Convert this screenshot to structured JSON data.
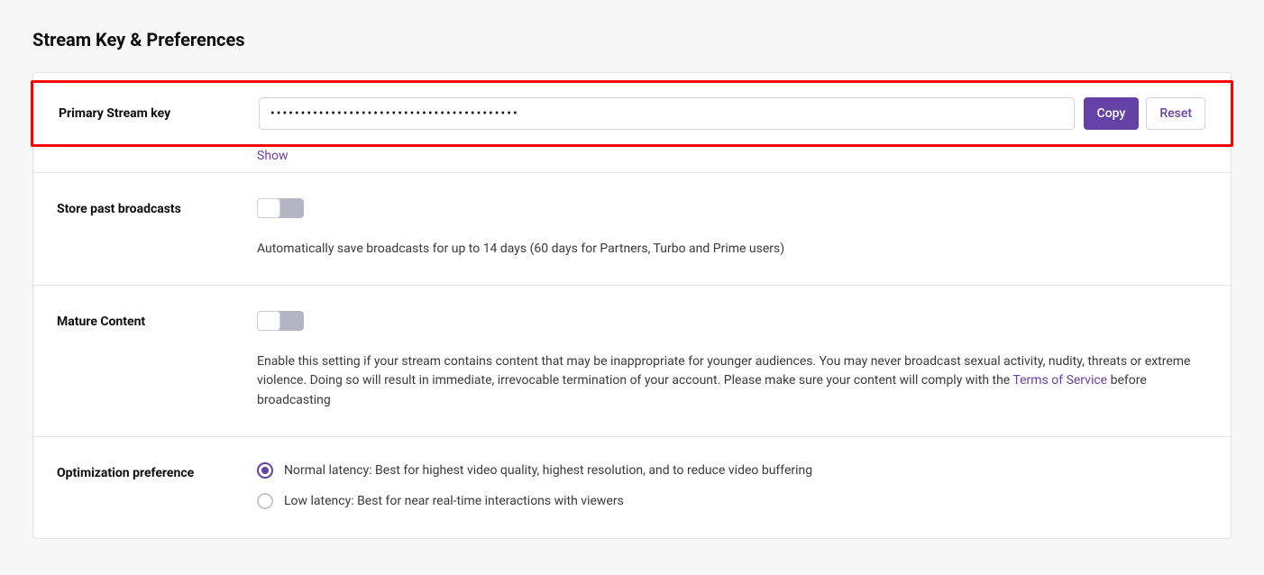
{
  "page_title": "Stream Key & Preferences",
  "stream_key": {
    "label": "Primary Stream key",
    "value": "•••••••••••••••••••••••••••••••••••••••••",
    "copy_label": "Copy",
    "reset_label": "Reset",
    "show_label": "Show"
  },
  "store_broadcasts": {
    "label": "Store past broadcasts",
    "enabled": false,
    "description": "Automatically save broadcasts for up to 14 days (60 days for Partners, Turbo and Prime users)"
  },
  "mature_content": {
    "label": "Mature Content",
    "enabled": false,
    "description_pre": "Enable this setting if your stream contains content that may be inappropriate for younger audiences. You may never broadcast sexual activity, nudity, threats or extreme violence. Doing so will result in immediate, irrevocable termination of your account. Please make sure your content will comply with the ",
    "tos_link": "Terms of Service",
    "description_post": " before broadcasting"
  },
  "optimization": {
    "label": "Optimization preference",
    "selected": "normal",
    "options": {
      "normal": "Normal latency: Best for highest video quality, highest resolution, and to reduce video buffering",
      "low": "Low latency: Best for near real-time interactions with viewers"
    }
  }
}
